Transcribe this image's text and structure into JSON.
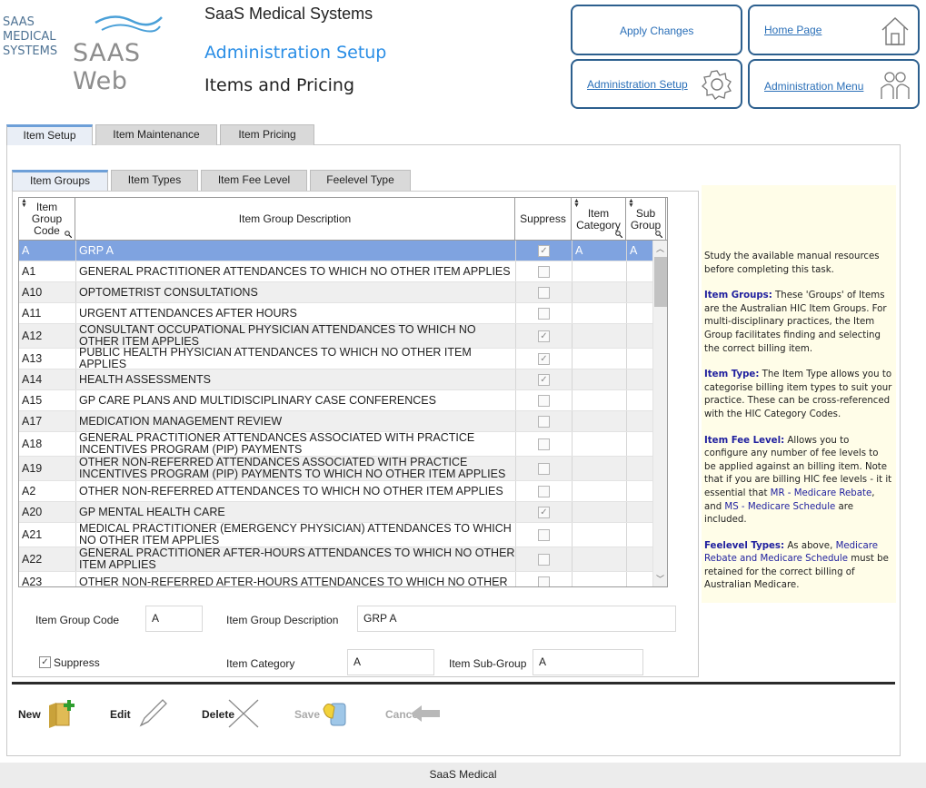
{
  "logo": {
    "small_lines": [
      "SAAS",
      "MEDICAL",
      "SYSTEMS"
    ],
    "wordmark": "SAAS Web"
  },
  "header": {
    "company": "SaaS Medical Systems",
    "section": "Administration Setup",
    "page": "Items and Pricing"
  },
  "nav": {
    "apply": "Apply Changes",
    "home": "Home Page",
    "admin_setup": "Administration Setup",
    "admin_menu": "Administration Menu"
  },
  "tabs": [
    "Item Setup",
    "Item Maintenance",
    "Item Pricing"
  ],
  "subtabs": [
    "Item Groups",
    "Item Types",
    "Item Fee Level",
    "Feelevel Type"
  ],
  "grid": {
    "headers": {
      "code": [
        "Item",
        "Group",
        "Code"
      ],
      "desc": "Item Group Description",
      "suppress": "Suppress",
      "category": [
        "Item",
        "Category"
      ],
      "subgroup": [
        "Sub",
        "Group"
      ]
    },
    "rows": [
      {
        "code": "A",
        "desc": "GRP A",
        "suppress": true,
        "cat": "A",
        "sub": "A",
        "selected": true
      },
      {
        "code": "A1",
        "desc": "GENERAL PRACTITIONER ATTENDANCES TO WHICH NO OTHER ITEM APPLIES",
        "suppress": false,
        "cat": "",
        "sub": ""
      },
      {
        "code": "A10",
        "desc": "OPTOMETRIST CONSULTATIONS",
        "suppress": false,
        "cat": "",
        "sub": ""
      },
      {
        "code": "A11",
        "desc": "URGENT ATTENDANCES AFTER HOURS",
        "suppress": false,
        "cat": "",
        "sub": ""
      },
      {
        "code": "A12",
        "desc": "CONSULTANT OCCUPATIONAL PHYSICIAN ATTENDANCES TO WHICH NO OTHER ITEM APPLIES",
        "suppress": true,
        "cat": "",
        "sub": "",
        "tall": true
      },
      {
        "code": "A13",
        "desc": "PUBLIC HEALTH PHYSICIAN ATTENDANCES TO WHICH NO OTHER ITEM APPLIES",
        "suppress": true,
        "cat": "",
        "sub": ""
      },
      {
        "code": "A14",
        "desc": "HEALTH ASSESSMENTS",
        "suppress": true,
        "cat": "",
        "sub": ""
      },
      {
        "code": "A15",
        "desc": "GP CARE PLANS AND MULTIDISCIPLINARY CASE CONFERENCES",
        "suppress": false,
        "cat": "",
        "sub": ""
      },
      {
        "code": "A17",
        "desc": "MEDICATION MANAGEMENT REVIEW",
        "suppress": false,
        "cat": "",
        "sub": ""
      },
      {
        "code": "A18",
        "desc": "GENERAL PRACTITIONER ATTENDANCES ASSOCIATED WITH PRACTICE INCENTIVES PROGRAM (PIP) PAYMENTS",
        "suppress": false,
        "cat": "",
        "sub": "",
        "tall": true
      },
      {
        "code": "A19",
        "desc": "OTHER NON-REFERRED ATTENDANCES ASSOCIATED WITH PRACTICE INCENTIVES PROGRAM (PIP) PAYMENTS TO WHICH NO OTHER ITEM APPLIES",
        "suppress": false,
        "cat": "",
        "sub": "",
        "tall": true
      },
      {
        "code": "A2",
        "desc": "OTHER NON-REFERRED ATTENDANCES TO WHICH NO OTHER ITEM APPLIES",
        "suppress": false,
        "cat": "",
        "sub": ""
      },
      {
        "code": "A20",
        "desc": "GP MENTAL HEALTH CARE",
        "suppress": true,
        "cat": "",
        "sub": ""
      },
      {
        "code": "A21",
        "desc": "MEDICAL PRACTITIONER (EMERGENCY PHYSICIAN) ATTENDANCES TO WHICH NO OTHER ITEM APPLIES",
        "suppress": false,
        "cat": "",
        "sub": "",
        "tall": true
      },
      {
        "code": "A22",
        "desc": "GENERAL PRACTITIONER AFTER-HOURS ATTENDANCES TO WHICH NO OTHER ITEM APPLIES",
        "suppress": false,
        "cat": "",
        "sub": "",
        "tall": true
      },
      {
        "code": "A23",
        "desc": "OTHER NON-REFERRED AFTER-HOURS ATTENDANCES TO WHICH NO OTHER",
        "suppress": false,
        "cat": "",
        "sub": ""
      }
    ]
  },
  "form": {
    "code_label": "Item Group Code",
    "code_value": "A",
    "desc_label": "Item Group Description",
    "desc_value": "GRP A",
    "suppress_label": "Suppress",
    "category_label": "Item Category",
    "category_value": "A",
    "subgroup_label": "Item Sub-Group",
    "subgroup_value": "A"
  },
  "help": {
    "intro": "Study the available manual resources before completing this task.",
    "groups_title": "Item Groups:",
    "groups_text": " These 'Groups' of Items are the Australian HIC Item Groups. For multi-disciplinary practices, the Item Group facilitates finding and selecting the correct billing item.",
    "type_title": "Item Type:",
    "type_text": " The Item Type allows you to categorise billing item types to suit your practice. These can be cross-referenced with the HIC Category Codes.",
    "fee_title": "Item Fee Level:",
    "fee_text_1": " Allows you to configure any number of fee levels to be applied against an billing item. Note that if you are billing HIC fee levels - it it essential that ",
    "fee_hl_1": "MR - Medicare Rebate",
    "fee_text_2": ", and ",
    "fee_hl_2": "MS - Medicare Schedule",
    "fee_text_3": " are included.",
    "feelevel_title": "Feelevel Types:",
    "feelevel_text_1": " As above, ",
    "feelevel_hl": "Medicare Rebate and Medicare Schedule",
    "feelevel_text_2": " must be retained for the correct billing of Australian Medicare."
  },
  "actions": {
    "new": "New",
    "edit": "Edit",
    "delete": "Delete",
    "save": "Save",
    "cancel": "Cancel"
  },
  "footer": "SaaS Medical",
  "colors": {
    "accent": "#2c5f8e",
    "selected_row": "#7fa3e0",
    "title_blue": "#2a8ee6"
  }
}
